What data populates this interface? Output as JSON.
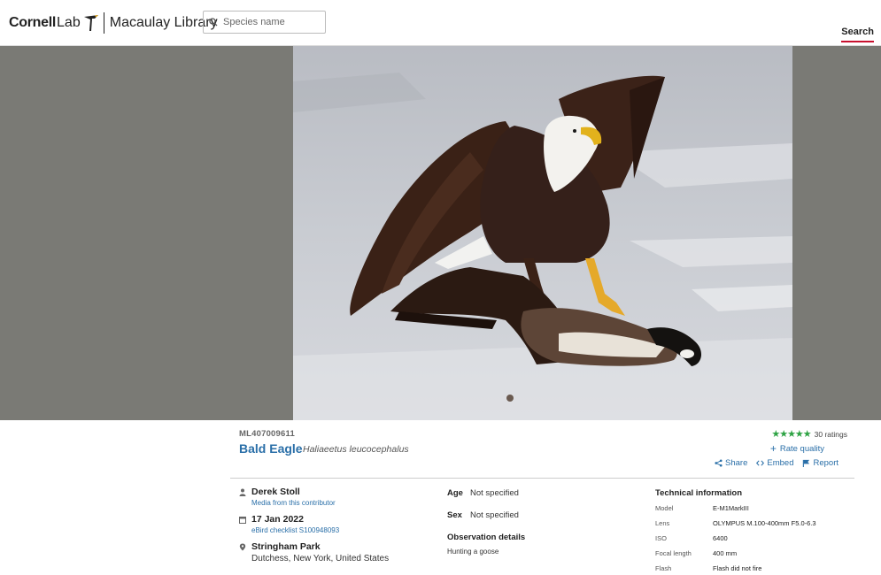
{
  "header": {
    "logo_cornell": "Cornell",
    "logo_lab": "Lab",
    "logo_library": "Macaulay Library",
    "search_placeholder": "Species name",
    "nav_search": "Search"
  },
  "media": {
    "catalog_id": "ML407009611",
    "common_name": "Bald Eagle",
    "scientific_name": "Haliaeetus leucocephalus",
    "rating_stars": 5,
    "rating_count": "30 ratings",
    "rate_quality": "Rate quality",
    "actions": {
      "share": "Share",
      "embed": "Embed",
      "report": "Report"
    }
  },
  "contributor": {
    "name": "Derek Stoll",
    "link": "Media from this contributor"
  },
  "date": {
    "value": "17 Jan 2022",
    "checklist": "eBird checklist S100948093"
  },
  "location": {
    "name": "Stringham Park",
    "region": "Dutchess, New York, United States"
  },
  "observation": {
    "age_label": "Age",
    "age_value": "Not specified",
    "sex_label": "Sex",
    "sex_value": "Not specified",
    "details_title": "Observation details",
    "details_text": "Hunting a goose"
  },
  "technical": {
    "title": "Technical information",
    "rows": [
      {
        "label": "Model",
        "value": "E-M1MarkIII"
      },
      {
        "label": "Lens",
        "value": "OLYMPUS M.100-400mm F5.0-6.3"
      },
      {
        "label": "ISO",
        "value": "6400"
      },
      {
        "label": "Focal length",
        "value": "400 mm"
      },
      {
        "label": "Flash",
        "value": "Flash did not fire"
      }
    ]
  },
  "colors": {
    "link": "#2a6fa8",
    "star": "#2ea344",
    "accent": "#c8102e",
    "photo_band": "#7a7a75"
  }
}
